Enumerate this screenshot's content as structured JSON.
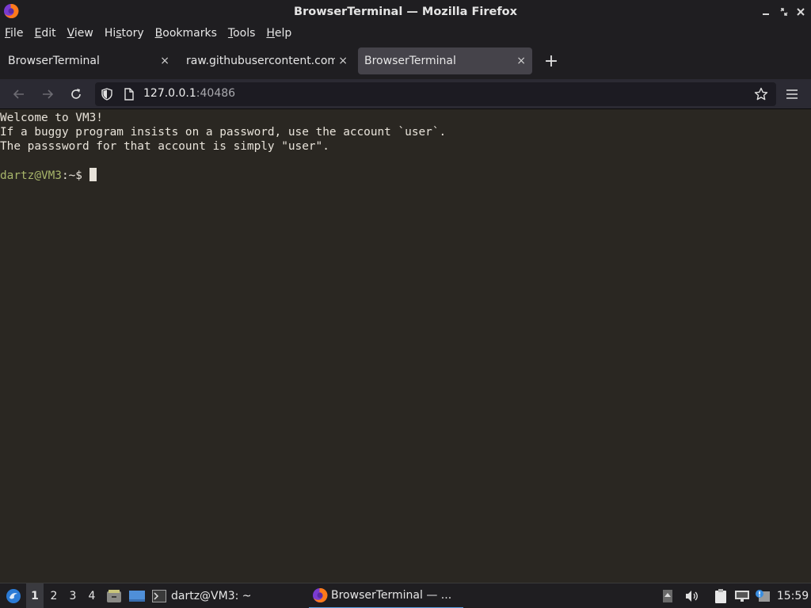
{
  "window": {
    "title": "BrowserTerminal — Mozilla Firefox"
  },
  "menu": [
    {
      "label": "File",
      "key": "F",
      "rest": "ile"
    },
    {
      "label": "Edit",
      "key": "E",
      "rest": "dit"
    },
    {
      "label": "View",
      "key": "V",
      "rest": "iew"
    },
    {
      "label": "History",
      "key": "",
      "pre": "Hi",
      "mid": "s",
      "post": "tory"
    },
    {
      "label": "Bookmarks",
      "key": "B",
      "rest": "ookmarks"
    },
    {
      "label": "Tools",
      "key": "T",
      "rest": "ools"
    },
    {
      "label": "Help",
      "key": "H",
      "rest": "elp"
    }
  ],
  "tabs": [
    {
      "label": "BrowserTerminal",
      "close": "×"
    },
    {
      "label": "raw.githubusercontent.com/",
      "close": "×"
    },
    {
      "label": "BrowserTerminal",
      "close": "×"
    }
  ],
  "new_tab_label": "+",
  "url": {
    "host": "127.0.0.1",
    "port": ":40486"
  },
  "terminal": {
    "lines": [
      "Welcome to VM3!",
      "If a buggy program insists on a password, use the account `user`.",
      "The passsword for that account is simply \"user\".",
      ""
    ],
    "prompt": "dartz@VM3:~$",
    "prompt_user": "dartz@VM3",
    "prompt_path": ":~$ "
  },
  "taskbar": {
    "workspaces": [
      "1",
      "2",
      "3",
      "4"
    ],
    "active_workspace": "1",
    "tasks": [
      {
        "label": "dartz@VM3: ~",
        "icon": "terminal-icon"
      },
      {
        "label": "BrowserTerminal — ...",
        "icon": "firefox-icon"
      }
    ],
    "clock": "15:59"
  },
  "colors": {
    "titlebar": "#1f1e21",
    "terminal_bg": "#2a2722",
    "prompt": "#a7b56a",
    "accent": "#5a9ee0"
  }
}
